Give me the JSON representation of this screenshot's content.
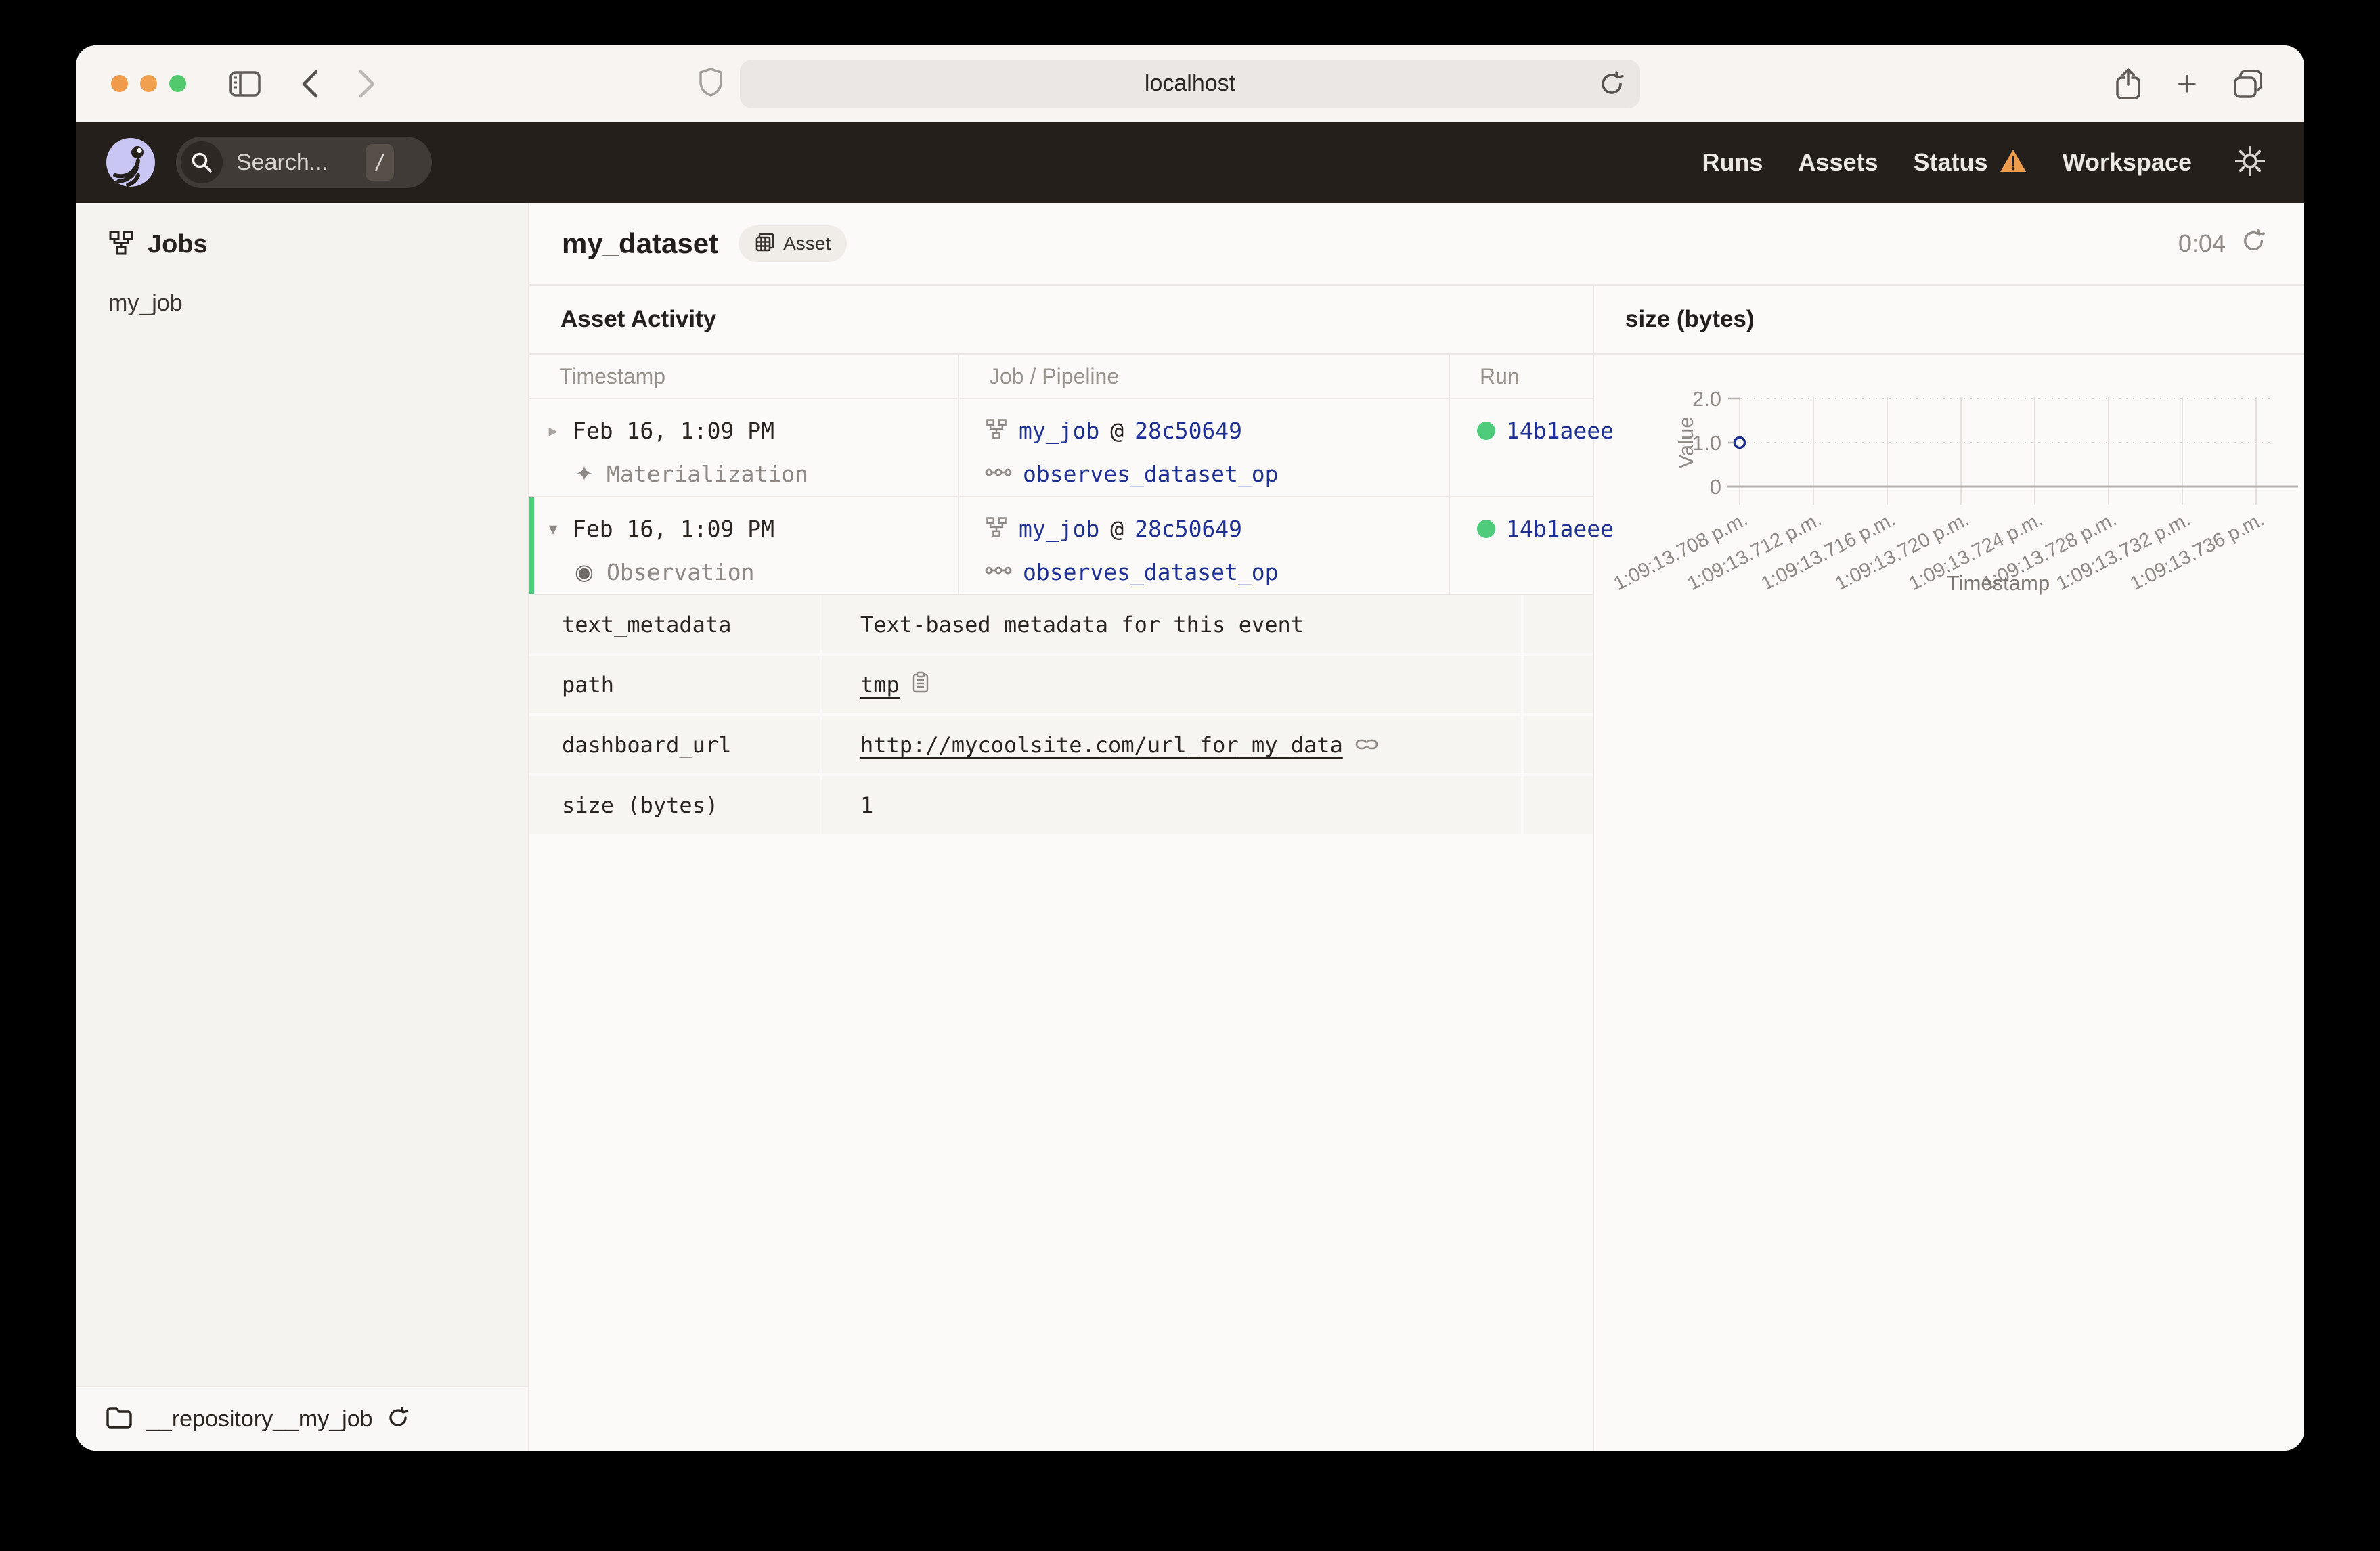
{
  "browser": {
    "url": "localhost"
  },
  "icons": {
    "collapsed": "▸",
    "expanded": "▾",
    "materialization": "✦",
    "observation": "◉",
    "plus": "+"
  },
  "app_header": {
    "search_placeholder": "Search...",
    "search_shortcut": "/",
    "nav": [
      "Runs",
      "Assets",
      "Status",
      "Workspace"
    ]
  },
  "sidebar": {
    "section_title": "Jobs",
    "jobs": [
      "my_job"
    ],
    "repository": "__repository__my_job"
  },
  "page": {
    "title": "my_dataset",
    "badge": "Asset",
    "timer": "0:04"
  },
  "activity": {
    "title": "Asset Activity",
    "columns": [
      "Timestamp",
      "Job / Pipeline",
      "Run"
    ],
    "rows": [
      {
        "timestamp": "Feb 16, 1:09 PM",
        "event_type": "Materialization",
        "job": "my_job",
        "at": "@",
        "run_tag": "28c50649",
        "op": "observes_dataset_op",
        "run_id": "14b1aeee"
      },
      {
        "timestamp": "Feb 16, 1:09 PM",
        "event_type": "Observation",
        "job": "my_job",
        "at": "@",
        "run_tag": "28c50649",
        "op": "observes_dataset_op",
        "run_id": "14b1aeee"
      }
    ],
    "metadata": [
      {
        "key": "text_metadata",
        "value": "Text-based metadata for this event"
      },
      {
        "key": "path",
        "value": "tmp"
      },
      {
        "key": "dashboard_url",
        "value": "http://mycoolsite.com/url_for_my_data"
      },
      {
        "key": "size (bytes)",
        "value": "1"
      }
    ]
  },
  "chart_data": {
    "type": "scatter",
    "title": "size (bytes)",
    "xlabel": "Timestamp",
    "ylabel": "Value",
    "x_ticks": [
      "1:09:13.708 p.m.",
      "1:09:13.712 p.m.",
      "1:09:13.716 p.m.",
      "1:09:13.720 p.m.",
      "1:09:13.724 p.m.",
      "1:09:13.728 p.m.",
      "1:09:13.732 p.m.",
      "1:09:13.736 p.m."
    ],
    "y_ticks": [
      "2.0",
      "1.0",
      "0"
    ],
    "ylim": [
      0,
      2
    ],
    "grid": true,
    "legend": "none",
    "points": [
      {
        "x": "1:09:13.708 p.m.",
        "y": 1
      }
    ]
  },
  "colors": {
    "success_green": "#4ecb7b",
    "link_navy": "#1f3093",
    "warning_orange": "#ee9d4d",
    "header_dark": "#241f1b",
    "logo_lavender": "#c9c6f3"
  }
}
